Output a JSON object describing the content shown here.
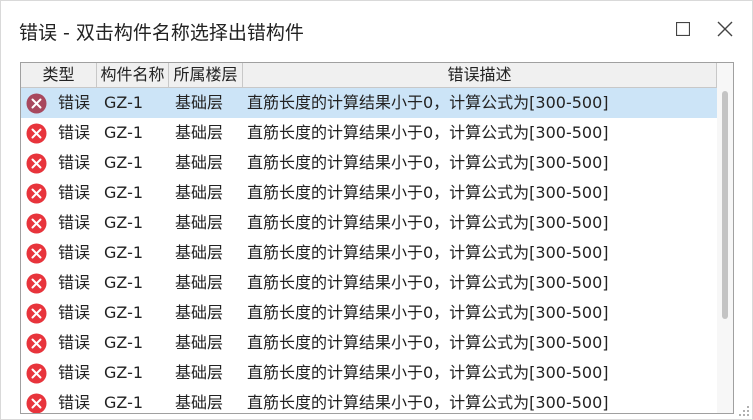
{
  "window": {
    "title": "错误 - 双击构件名称选择出错构件"
  },
  "columns": {
    "type": "类型",
    "name": "构件名称",
    "floor": "所属楼层",
    "desc": "错误描述"
  },
  "rows": [
    {
      "type": "错误",
      "name": "GZ-1",
      "floor": "基础层",
      "desc": "直筋长度的计算结果小于0，计算公式为[300-500]",
      "selected": true
    },
    {
      "type": "错误",
      "name": "GZ-1",
      "floor": "基础层",
      "desc": "直筋长度的计算结果小于0，计算公式为[300-500]"
    },
    {
      "type": "错误",
      "name": "GZ-1",
      "floor": "基础层",
      "desc": "直筋长度的计算结果小于0，计算公式为[300-500]"
    },
    {
      "type": "错误",
      "name": "GZ-1",
      "floor": "基础层",
      "desc": "直筋长度的计算结果小于0，计算公式为[300-500]"
    },
    {
      "type": "错误",
      "name": "GZ-1",
      "floor": "基础层",
      "desc": "直筋长度的计算结果小于0，计算公式为[300-500]"
    },
    {
      "type": "错误",
      "name": "GZ-1",
      "floor": "基础层",
      "desc": "直筋长度的计算结果小于0，计算公式为[300-500]"
    },
    {
      "type": "错误",
      "name": "GZ-1",
      "floor": "基础层",
      "desc": "直筋长度的计算结果小于0，计算公式为[300-500]"
    },
    {
      "type": "错误",
      "name": "GZ-1",
      "floor": "基础层",
      "desc": "直筋长度的计算结果小于0，计算公式为[300-500]"
    },
    {
      "type": "错误",
      "name": "GZ-1",
      "floor": "基础层",
      "desc": "直筋长度的计算结果小于0，计算公式为[300-500]"
    },
    {
      "type": "错误",
      "name": "GZ-1",
      "floor": "基础层",
      "desc": "直筋长度的计算结果小于0，计算公式为[300-500]"
    },
    {
      "type": "错误",
      "name": "GZ-1",
      "floor": "基础层",
      "desc": "直筋长度的计算结果小于0，计算公式为[300-500]"
    }
  ],
  "icons": {
    "row": "error-icon",
    "maximize": "maximize-icon",
    "close": "close-icon"
  },
  "colors": {
    "error": "#e8343c",
    "error_selected": "#a8485e",
    "selection": "#cce4f7"
  }
}
